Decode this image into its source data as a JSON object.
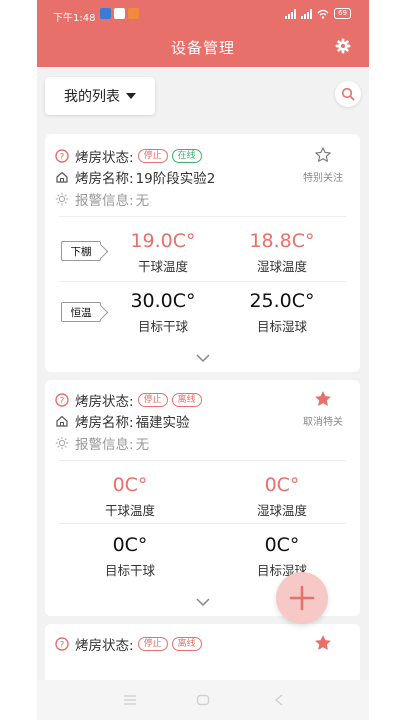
{
  "status_bar": {
    "time": "下午1:48",
    "battery": "69"
  },
  "app_bar": {
    "title": "设备管理",
    "settings_icon": "gear-icon"
  },
  "toolbar": {
    "list_selector": "我的列表",
    "search_icon": "search-icon"
  },
  "labels": {
    "status": "烤房状态:",
    "name": "烤房名称:",
    "alarm": "报警信息:"
  },
  "colors": {
    "primary": "#e8706a",
    "online_green": "#3bb36b",
    "fab_bg": "#f6c9c6"
  },
  "devices": [
    {
      "run_state": "停止",
      "conn_state": "在线",
      "name": "19阶段实验2",
      "alarm": "无",
      "favorite_label": "特别关注",
      "favorited": false,
      "stage_tag": "下棚",
      "dry_bulb_temp": "19.0C°",
      "dry_bulb_label": "干球温度",
      "wet_bulb_temp": "18.8C°",
      "wet_bulb_label": "湿球温度",
      "mode_tag": "恒温",
      "target_dry": "30.0C°",
      "target_dry_label": "目标干球",
      "target_wet": "25.0C°",
      "target_wet_label": "目标湿球"
    },
    {
      "run_state": "停止",
      "conn_state": "离线",
      "name": "福建实验",
      "alarm": "无",
      "favorite_label": "取消特关",
      "favorited": true,
      "dry_bulb_temp": "0C°",
      "dry_bulb_label": "干球温度",
      "wet_bulb_temp": "0C°",
      "wet_bulb_label": "湿球温度",
      "target_dry": "0C°",
      "target_dry_label": "目标干球",
      "target_wet": "0C°",
      "target_wet_label": "目标湿球"
    },
    {
      "run_state": "停止",
      "conn_state": "离线",
      "favorited": true
    }
  ]
}
